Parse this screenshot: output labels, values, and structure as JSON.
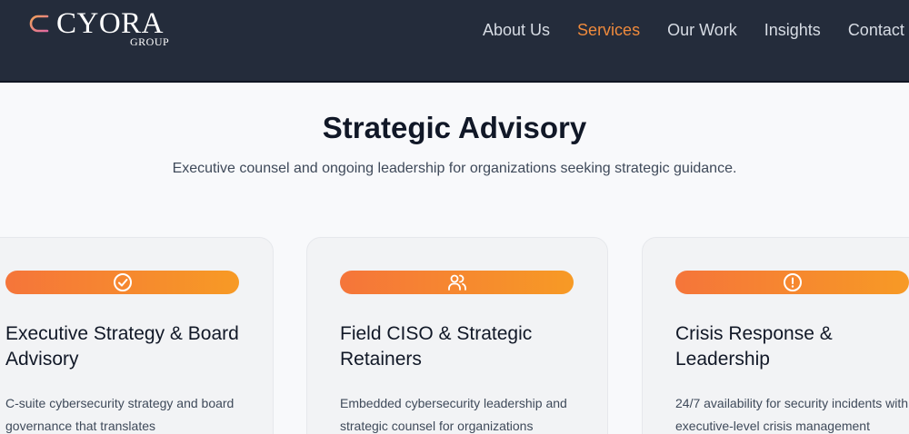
{
  "brand": {
    "name": "CYORA",
    "sub": "GROUP"
  },
  "nav": [
    {
      "label": "About Us",
      "active": false
    },
    {
      "label": "Services",
      "active": true
    },
    {
      "label": "Our Work",
      "active": false
    },
    {
      "label": "Insights",
      "active": false
    },
    {
      "label": "Contact",
      "active": false
    }
  ],
  "colors": {
    "header_bg": "#242c3b",
    "accent": "#ef8a3c",
    "gradient_start": "#f5753a",
    "gradient_end": "#f79a25"
  },
  "hero": {
    "title": "Strategic Advisory",
    "subtitle": "Executive counsel and ongoing leadership for organizations seeking strategic guidance."
  },
  "cards": [
    {
      "icon": "check-circle-icon",
      "title": "Executive Strategy & Board Advisory",
      "desc": "C-suite cybersecurity strategy and board governance that translates"
    },
    {
      "icon": "users-icon",
      "title": "Field CISO & Strategic Retainers",
      "desc": "Embedded cybersecurity leadership and strategic counsel for organizations"
    },
    {
      "icon": "alert-circle-icon",
      "title": "Crisis Response & Leadership",
      "desc": "24/7 availability for security incidents with executive-level crisis management"
    }
  ]
}
